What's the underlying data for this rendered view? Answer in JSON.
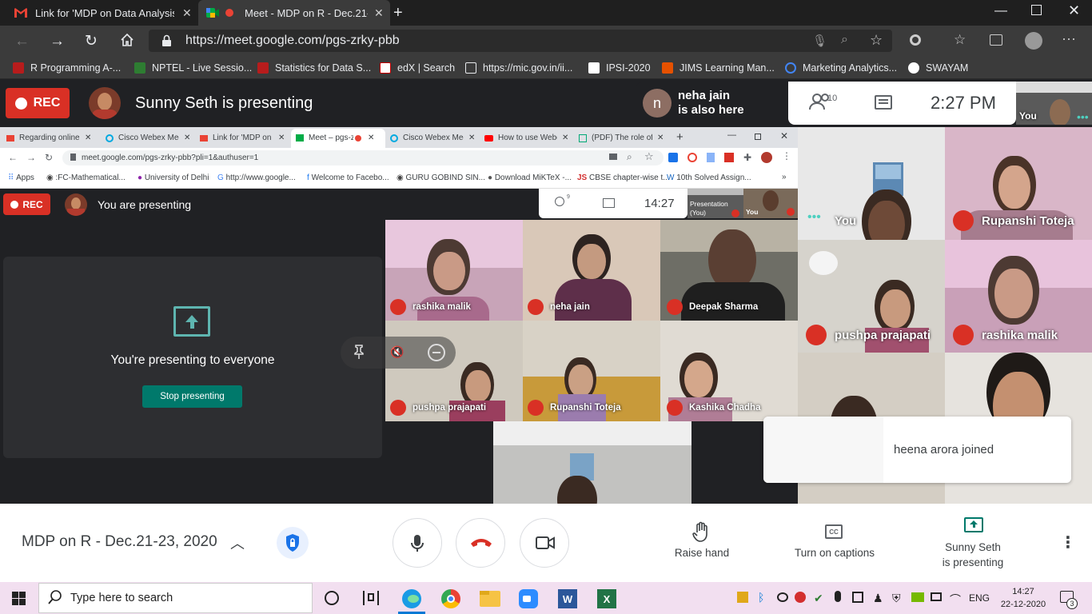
{
  "browser": {
    "tabs": [
      {
        "title": "Link for 'MDP on Data Analysis u",
        "icon": "gmail-icon"
      },
      {
        "title": "Meet - MDP on R - Dec.21-",
        "icon": "meet-icon",
        "recording": true
      }
    ],
    "url": "https://meet.google.com/pgs-zrky-pbb",
    "bookmarks": [
      "R Programming A-...",
      "NPTEL - Live Sessio...",
      "Statistics for Data S...",
      "edX | Search",
      "https://mic.gov.in/ii...",
      "IPSI-2020",
      "JIMS Learning Man...",
      "Marketing Analytics...",
      "SWAYAM"
    ]
  },
  "meet": {
    "rec_label": "REC",
    "presenting_banner": "Sunny Seth is presenting",
    "also_here_initial": "n",
    "also_here_name": "neha jain",
    "also_here_text": "is also here",
    "people_count": "10",
    "time": "2:27 PM",
    "self_label": "You",
    "tiles": [
      {
        "name": "You",
        "muted": false
      },
      {
        "name": "Rupanshi Toteja",
        "muted": true
      },
      {
        "name": "pushpa prajapati",
        "muted": true
      },
      {
        "name": "rashika malik",
        "muted": true
      }
    ],
    "toast": "heena arora joined",
    "meeting_title": "MDP on R - Dec.21-23, 2020",
    "controls": {
      "raise_hand": "Raise hand",
      "captions": "Turn on captions",
      "presenting_line1": "Sunny Seth",
      "presenting_line2": "is presenting"
    }
  },
  "shared": {
    "tabs": [
      "Regarding online",
      "Cisco Webex Mee",
      "Link for 'MDP on",
      "Meet – pgs-zr",
      "Cisco Webex Mee",
      "How to use Webe",
      "(PDF) The role of"
    ],
    "url": "meet.google.com/pgs-zrky-pbb?pli=1&authuser=1",
    "bookmarks": [
      "Apps",
      ":FC-Mathematical...",
      "University of Delhi",
      "http://www.google...",
      "Welcome to Facebo...",
      "GURU GOBIND SIN...",
      "Download MiKTeX -...",
      "CBSE chapter-wise t...",
      "10th Solved Assign..."
    ],
    "rec_label": "REC",
    "you_presenting": "You are presenting",
    "people_count": "9",
    "time": "14:27",
    "presentation_label": "Presentation (You)",
    "you_label": "You",
    "presenting_everyone": "You're presenting to everyone",
    "stop_presenting": "Stop presenting",
    "tiles": [
      "rashika malik",
      "neha jain",
      "Deepak Sharma",
      "pushpa prajapati",
      "Rupanshi Toteja",
      "Kashika Chadha"
    ]
  },
  "taskbar": {
    "search_placeholder": "Type here to search",
    "language": "ENG",
    "time": "14:27",
    "date": "22-12-2020",
    "notification_count": "3"
  },
  "colors": {
    "rec": "#d93025",
    "teal": "#00796b",
    "meet_dark": "#202124",
    "taskbar": "#f2dff0"
  }
}
